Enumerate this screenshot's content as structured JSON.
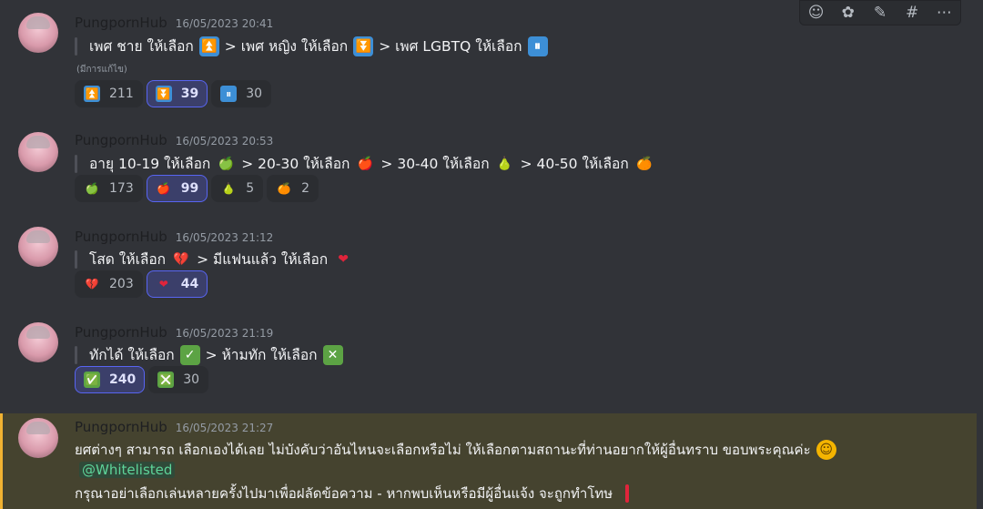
{
  "toolbar": {
    "icons": [
      "add-reaction-icon",
      "add-super-reaction-icon",
      "edit-icon",
      "thread-icon",
      "more-icon"
    ],
    "glyphs": [
      "☺",
      "✿",
      "✎",
      "#",
      "⋯"
    ]
  },
  "messages": [
    {
      "username": "PungpornHub",
      "timestamp": "16/05/2023 20:41",
      "parts": [
        "เพศ ชาย ให้เลือก",
        "> เพศ หญิง ให้เลือก",
        "> เพศ LGBTQ ให้เลือก"
      ],
      "edited": "(มีการแก้ไข)",
      "reactions": [
        {
          "emoji": "⏫",
          "count": "211",
          "active": false
        },
        {
          "emoji": "⏬",
          "count": "39",
          "active": true
        },
        {
          "emoji": "⏸",
          "count": "30",
          "active": false
        }
      ]
    },
    {
      "username": "PungpornHub",
      "timestamp": "16/05/2023 20:53",
      "parts": [
        "อายุ 10-19 ให้เลือก",
        "> 20-30 ให้เลือก",
        "> 30-40 ให้เลือก",
        "> 40-50 ให้เลือก"
      ],
      "reactions": [
        {
          "emoji": "🍏",
          "count": "173",
          "active": false
        },
        {
          "emoji": "🍎",
          "count": "99",
          "active": true
        },
        {
          "emoji": "🍐",
          "count": "5",
          "active": false
        },
        {
          "emoji": "🍊",
          "count": "2",
          "active": false
        }
      ]
    },
    {
      "username": "PungpornHub",
      "timestamp": "16/05/2023 21:12",
      "parts": [
        "โสด ให้เลือก",
        "> มีแฟนแล้ว ให้เลือก"
      ],
      "reactions": [
        {
          "emoji": "💔",
          "count": "203",
          "active": false
        },
        {
          "emoji": "❤",
          "count": "44",
          "active": true
        }
      ]
    },
    {
      "username": "PungpornHub",
      "timestamp": "16/05/2023 21:19",
      "parts": [
        "ทักได้ ให้เลือก",
        "> ห้ามทัก ให้เลือก"
      ],
      "reactions": [
        {
          "emoji": "✅",
          "count": "240",
          "active": true
        },
        {
          "emoji": "❎",
          "count": "30",
          "active": false
        }
      ]
    },
    {
      "username": "PungpornHub",
      "timestamp": "16/05/2023 21:27",
      "line1": "ยศต่างๆ สามารถ เลือกเองได้เลย ไม่บังคับว่าอันไหนจะเลือกหรือไม่ ให้เลือกตามสถานะที่ท่านอยากให้ผู้อื่นทราบ ขอบพระคุณค่ะ",
      "mention": "@Whitelisted",
      "line3": "กรุณาอย่าเลือกเล่นหลายครั้งไปมาเพื่อฝลัดข้อความ - หากพบเห็นหรือมีผู้อื่นแจ้ง จะถูกทำโทษ"
    }
  ],
  "colors": {
    "accent": "#5865f2",
    "highlight": "#f0b232"
  }
}
